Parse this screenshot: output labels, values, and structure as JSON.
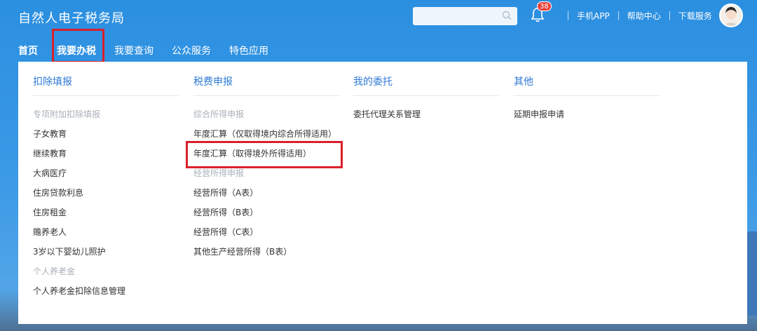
{
  "header": {
    "site_title": "自然人电子税务局",
    "search": {
      "placeholder": ""
    },
    "notifications": {
      "count": "38"
    },
    "links": [
      "手机APP",
      "帮助中心",
      "下载服务"
    ]
  },
  "nav": {
    "items": [
      "首页",
      "我要办税",
      "我要查询",
      "公众服务",
      "特色应用"
    ],
    "active_index": 1
  },
  "menu": {
    "columns": [
      {
        "title": "扣除填报",
        "groups": [
          {
            "label": "专项附加扣除填报",
            "items": [
              "子女教育",
              "继续教育",
              "大病医疗",
              "住房贷款利息",
              "住房租金",
              "赡养老人",
              "3岁以下婴幼儿照护"
            ]
          },
          {
            "label": "个人养老金",
            "items": [
              "个人养老金扣除信息管理"
            ]
          }
        ]
      },
      {
        "title": "税费申报",
        "groups": [
          {
            "label": "综合所得申报",
            "items": [
              "年度汇算（仅取得境内综合所得适用）",
              "年度汇算（取得境外所得适用）"
            ]
          },
          {
            "label": "经营所得申报",
            "items": [
              "经营所得（A表）",
              "经营所得（B表）",
              "经营所得（C表）",
              "其他生产经营所得（B表）"
            ]
          }
        ]
      },
      {
        "title": "我的委托",
        "groups": [
          {
            "label": "",
            "items": [
              "委托代理关系管理"
            ]
          }
        ]
      },
      {
        "title": "其他",
        "groups": [
          {
            "label": "",
            "items": [
              "延期申报申请"
            ]
          }
        ]
      }
    ]
  },
  "colors": {
    "brand_blue": "#2b8fe0",
    "link_blue": "#2e7ad6",
    "highlight_red": "#d9202c"
  }
}
